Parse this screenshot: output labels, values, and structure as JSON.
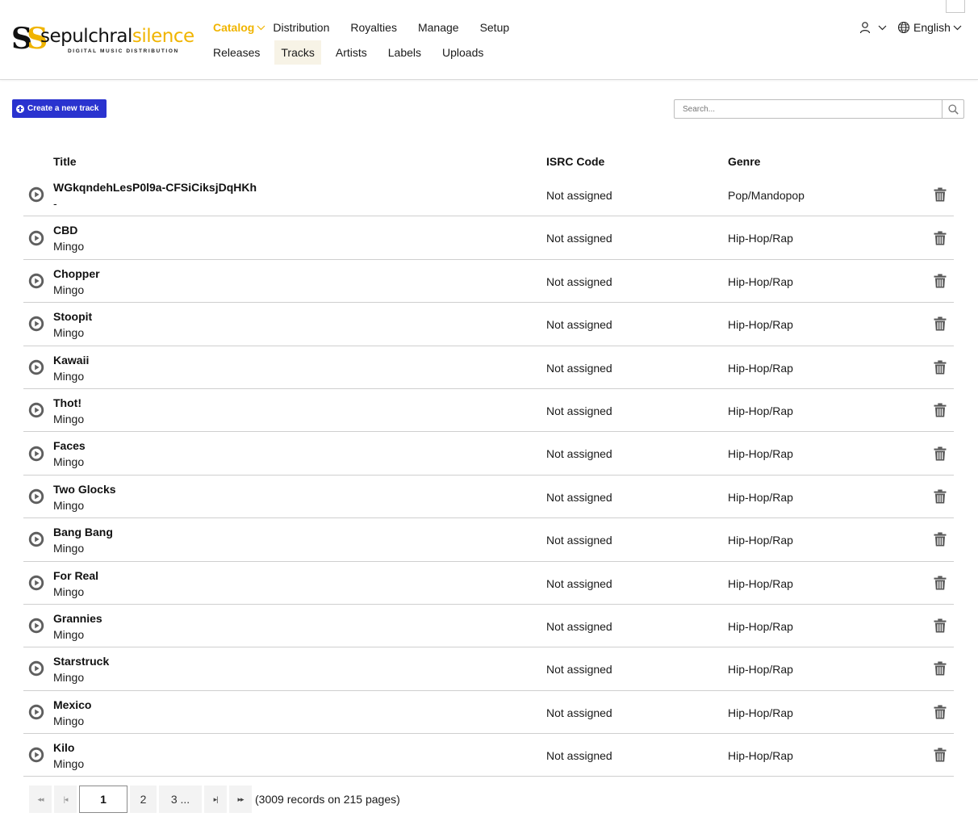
{
  "brand": {
    "mark_1": "S",
    "mark_2": "S",
    "word_1": "sepulchral",
    "word_2": "silence",
    "tagline": "DIGITAL MUSIC DISTRIBUTION"
  },
  "nav": {
    "top": [
      "Catalog",
      "Distribution",
      "Royalties",
      "Manage",
      "Setup"
    ],
    "sub": [
      "Releases",
      "Tracks",
      "Artists",
      "Labels",
      "Uploads"
    ],
    "active_top": "Catalog",
    "active_sub": "Tracks"
  },
  "language": {
    "label": "English"
  },
  "toolbar": {
    "create_label": "Create a new track",
    "search_placeholder": "Search..."
  },
  "table": {
    "headers": {
      "title": "Title",
      "isrc": "ISRC Code",
      "genre": "Genre"
    },
    "rows": [
      {
        "title": "WGkqndehLesP0l9a-CFSiCiksjDqHKh",
        "artist": "-",
        "isrc": "Not assigned",
        "genre": "Pop/Mandopop"
      },
      {
        "title": "CBD",
        "artist": "Mingo",
        "isrc": "Not assigned",
        "genre": "Hip-Hop/Rap"
      },
      {
        "title": "Chopper",
        "artist": "Mingo",
        "isrc": "Not assigned",
        "genre": "Hip-Hop/Rap"
      },
      {
        "title": "Stoopit",
        "artist": "Mingo",
        "isrc": "Not assigned",
        "genre": "Hip-Hop/Rap"
      },
      {
        "title": "Kawaii",
        "artist": "Mingo",
        "isrc": "Not assigned",
        "genre": "Hip-Hop/Rap"
      },
      {
        "title": "Thot!",
        "artist": "Mingo",
        "isrc": "Not assigned",
        "genre": "Hip-Hop/Rap"
      },
      {
        "title": "Faces",
        "artist": "Mingo",
        "isrc": "Not assigned",
        "genre": "Hip-Hop/Rap"
      },
      {
        "title": "Two Glocks",
        "artist": "Mingo",
        "isrc": "Not assigned",
        "genre": "Hip-Hop/Rap"
      },
      {
        "title": "Bang Bang",
        "artist": "Mingo",
        "isrc": "Not assigned",
        "genre": "Hip-Hop/Rap"
      },
      {
        "title": "For Real",
        "artist": "Mingo",
        "isrc": "Not assigned",
        "genre": "Hip-Hop/Rap"
      },
      {
        "title": "Grannies",
        "artist": "Mingo",
        "isrc": "Not assigned",
        "genre": "Hip-Hop/Rap"
      },
      {
        "title": "Starstruck",
        "artist": "Mingo",
        "isrc": "Not assigned",
        "genre": "Hip-Hop/Rap"
      },
      {
        "title": "Mexico",
        "artist": "Mingo",
        "isrc": "Not assigned",
        "genre": "Hip-Hop/Rap"
      },
      {
        "title": "Kilo",
        "artist": "Mingo",
        "isrc": "Not assigned",
        "genre": "Hip-Hop/Rap"
      }
    ]
  },
  "pagination": {
    "current": "1",
    "page_2": "2",
    "page_3": "3 ...",
    "info": "(3009 records on 215 pages)"
  },
  "colors": {
    "accent": "#f0b400",
    "primary_button": "#2a33cf",
    "icon_gray": "#555555"
  },
  "icons": [
    "user-icon",
    "chevron-down-icon",
    "globe-icon",
    "search-icon",
    "play-icon",
    "trash-icon",
    "plus-circle-icon"
  ]
}
